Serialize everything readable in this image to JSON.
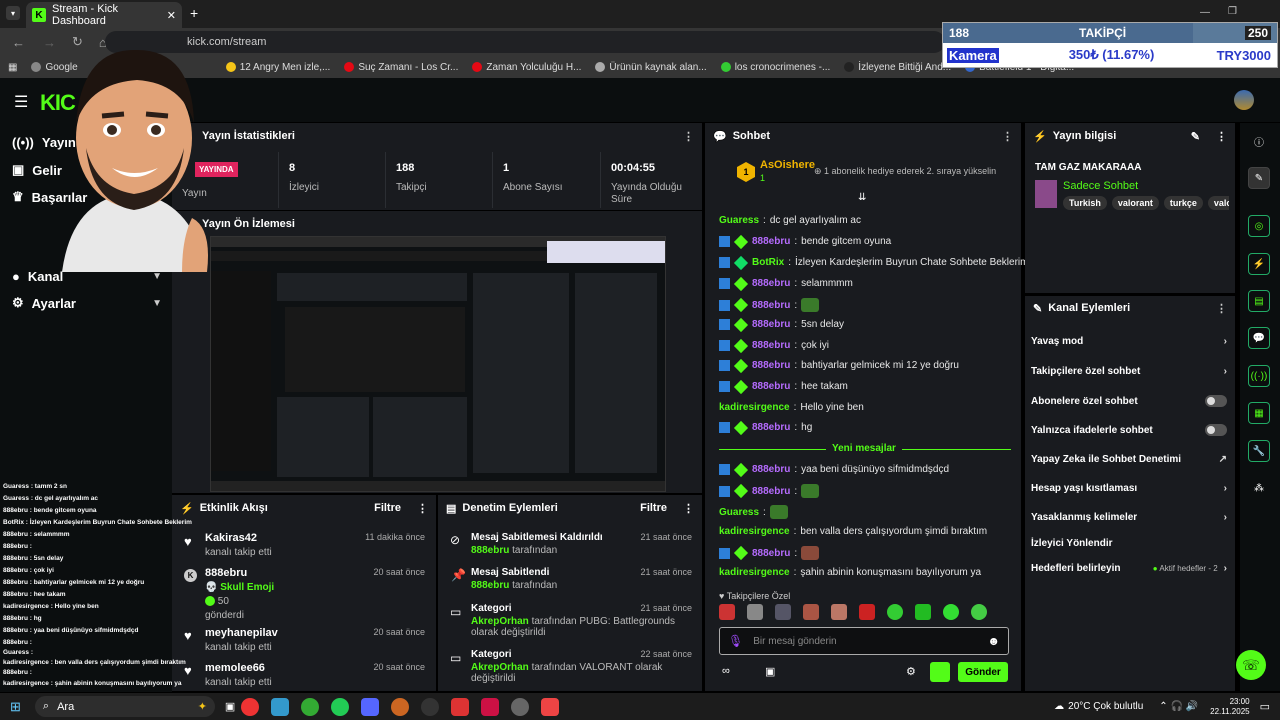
{
  "browser": {
    "tab_title": "Stream - Kick Dashboard",
    "url": "kick.com/stream",
    "bookmarks": [
      "Google",
      "12 Angry Men izle,...",
      "Suç Zamanı - Los Cr...",
      "Zaman Yolculuğu H...",
      "Ürünün kaynak alan...",
      "los cronocrimenes -...",
      "İzleyene Bittiği And...",
      "Battlefield 1 - Digita..."
    ]
  },
  "overlay_widget": {
    "count": "188",
    "title": "TAKİPÇİ",
    "goal": "250",
    "label": "Kamera",
    "amount": "350₺ (11.67%)",
    "target": "TRY3000"
  },
  "nav": {
    "items": [
      {
        "label": "Yayın"
      },
      {
        "label": "Gelir"
      },
      {
        "label": "Başarılar"
      },
      {
        "label": "Kanal"
      },
      {
        "label": "Ayarlar"
      }
    ]
  },
  "stats": {
    "header": "Yayın İstatistikleri",
    "live_badge": "YAYINDA",
    "live_label": "Yayın",
    "viewers": "8",
    "viewers_label": "İzleyici",
    "followers": "188",
    "followers_label": "Takipçi",
    "subs": "1",
    "subs_label": "Abone Sayısı",
    "uptime": "00:04:55",
    "uptime_label": "Yayında Olduğu Süre"
  },
  "preview": {
    "header": "Yayın Ön İzlemesi"
  },
  "activity": {
    "header": "Etkinlik Akışı",
    "filter": "Filtre",
    "items": [
      {
        "name": "Kakiras42",
        "sub": "kanalı takip etti",
        "time": "11 dakika önce"
      },
      {
        "name": "888ebru",
        "sub": "Skull Emoji",
        "extra": "50",
        "extra2": "gönderdi",
        "time": "20 saat önce"
      },
      {
        "name": "meyhanepilav",
        "sub": "kanalı takip etti",
        "time": "20 saat önce"
      },
      {
        "name": "memolee66",
        "sub": "kanalı takip etti",
        "time": "20 saat önce"
      }
    ]
  },
  "moderation": {
    "header": "Denetim Eylemleri",
    "filter": "Filtre",
    "items": [
      {
        "title": "Mesaj Sabitlemesi Kaldırıldı",
        "user": "888ebru",
        "rest": "tarafından",
        "time": "21 saat önce"
      },
      {
        "title": "Mesaj Sabitlendi",
        "user": "888ebru",
        "rest": "tarafından",
        "time": "21 saat önce"
      },
      {
        "title": "Kategori",
        "user": "AkrepOrhan",
        "rest": "tarafından PUBG: Battlegrounds olarak değiştirildi",
        "time": "21 saat önce"
      },
      {
        "title": "Kategori",
        "user": "AkrepOrhan",
        "rest": "tarafından VALORANT olarak değiştirildi",
        "time": "22 saat önce"
      }
    ]
  },
  "chat": {
    "header": "Sohbet",
    "top_user": "AsOishere",
    "top_rank": "1",
    "top_count": "1",
    "top_hint": "1 abonelik hediye ederek 2. sıraya yükselin",
    "new_messages": "Yeni mesajlar",
    "emote_tab": "Takipçilere Özel",
    "input_placeholder": "Bir mesaj gönderin",
    "send": "Gönder",
    "messages": [
      {
        "user": "Guaress",
        "text": "dc gel ayarlıyalım ac"
      },
      {
        "user": "888ebru",
        "text": "bende gitcem oyuna"
      },
      {
        "user": "BotRix",
        "text": "İzleyen Kardeşlerim Buyrun Chate Sohbete Beklerim"
      },
      {
        "user": "888ebru",
        "text": "selammmm"
      },
      {
        "user": "888ebru",
        "text": ""
      },
      {
        "user": "888ebru",
        "text": "5sn delay"
      },
      {
        "user": "888ebru",
        "text": "çok iyi"
      },
      {
        "user": "888ebru",
        "text": "bahtiyarlar gelmicek mi 12 ye doğru"
      },
      {
        "user": "888ebru",
        "text": "hee takam"
      },
      {
        "user": "kadiresirgence",
        "text": "Hello yine ben"
      },
      {
        "user": "888ebru",
        "text": "hg"
      },
      {
        "user": "888ebru",
        "text": "yaa beni düşünüyo sifmidmdşdçd"
      },
      {
        "user": "888ebru",
        "text": ""
      },
      {
        "user": "Guaress",
        "text": ""
      },
      {
        "user": "kadiresirgence",
        "text": "ben valla ders çalışıyordum şimdi bıraktım"
      },
      {
        "user": "888ebru",
        "text": ""
      },
      {
        "user": "kadiresirgence",
        "text": "şahin abinin konuşmasını bayılıyorum ya"
      }
    ]
  },
  "stream_info": {
    "header": "Yayın bilgisi",
    "title": "TAM GAZ MAKARAAA",
    "category": "Sadece Sohbet",
    "tags": [
      "Turkish",
      "valorant",
      "turkçe",
      "valora"
    ]
  },
  "channel_actions": {
    "header": "Kanal Eylemleri",
    "items": [
      {
        "label": "Yavaş mod",
        "type": "arrow"
      },
      {
        "label": "Takipçilere özel sohbet",
        "type": "arrow"
      },
      {
        "label": "Abonelere özel sohbet",
        "type": "toggle"
      },
      {
        "label": "Yalnızca ifadelerle sohbet",
        "type": "toggle"
      },
      {
        "label": "Yapay Zeka ile Sohbet Denetimi",
        "type": "ext"
      },
      {
        "label": "Hesap yaşı kısıtlaması",
        "type": "arrow"
      },
      {
        "label": "Yasaklanmış kelimeler",
        "type": "arrow"
      },
      {
        "label": "İzleyici Yönlendir",
        "type": "none"
      },
      {
        "label": "Hedefleri belirleyin",
        "type": "arrow",
        "status": "Aktif hedefler - 2"
      }
    ]
  },
  "overlay_chat": [
    "Guaress : tamm 2 sn",
    "Guaress : dc gel ayarlıyalım ac",
    "888ebru : bende gitcem oyuna",
    "BotRix : İzleyen Kardeşlerim Buyrun Chate Sohbete Beklerim",
    "888ebru : selammmm",
    "888ebru :",
    "888ebru : 5sn delay",
    "888ebru : çok iyi",
    "888ebru : bahtiyarlar gelmicek mi 12 ye doğru",
    "888ebru : hee takam",
    "kadiresirgence : Hello yine ben",
    "888ebru : hg",
    "888ebru : yaa beni düşünüyo sifmidmdşdçd",
    "888ebru :",
    "Guaress :",
    "kadiresirgence : ben valla ders çalışıyordum şimdi bıraktım",
    "888ebru :",
    "kadiresirgence : şahin abinin konuşmasını bayılıyorum ya"
  ],
  "taskbar": {
    "search": "Ara",
    "weather": "20°C  Çok bulutlu",
    "time": "23:00",
    "date": "22.11.2025"
  }
}
